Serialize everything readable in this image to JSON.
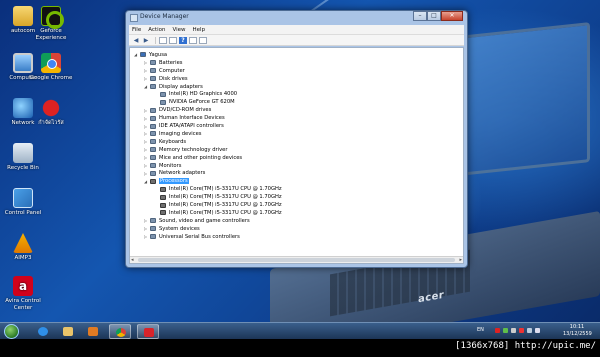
{
  "desktop": {
    "icons": [
      {
        "label": "autocom",
        "icon": "folder-icon"
      },
      {
        "label": "Geforce Experience",
        "icon": "geforce-icon"
      },
      {
        "label": "Computer",
        "icon": "computer-icon"
      },
      {
        "label": "Google Chrome",
        "icon": "chrome-icon"
      },
      {
        "label": "Network",
        "icon": "network-icon"
      },
      {
        "label": "กำจัดไวรัส",
        "icon": "bug-icon"
      },
      {
        "label": "Recycle Bin",
        "icon": "recycle-bin-icon"
      },
      {
        "label": "Control Panel",
        "icon": "control-panel-icon"
      },
      {
        "label": "AIMP3",
        "icon": "aimp-icon"
      },
      {
        "label": "Avira Control Center",
        "icon": "avira-icon"
      }
    ],
    "wallpaper_logo": "acer"
  },
  "window": {
    "title": "Device Manager",
    "controls": {
      "minimize": "–",
      "maximize": "□",
      "close": "✕"
    },
    "menu": [
      "File",
      "Action",
      "View",
      "Help"
    ],
    "tree": [
      {
        "label": "Yagusa",
        "level": 0,
        "expander": "◢",
        "icon": "computer-icon"
      },
      {
        "label": "Batteries",
        "level": 1,
        "expander": "▷",
        "icon": "battery-icon"
      },
      {
        "label": "Computer",
        "level": 1,
        "expander": "▷",
        "icon": "computer-icon"
      },
      {
        "label": "Disk drives",
        "level": 1,
        "expander": "▷",
        "icon": "disk-icon"
      },
      {
        "label": "Display adapters",
        "level": 1,
        "expander": "◢",
        "icon": "display-icon"
      },
      {
        "label": "Intel(R) HD Graphics 4000",
        "level": 2,
        "expander": "",
        "icon": "display-icon"
      },
      {
        "label": "NVIDIA GeForce GT 620M",
        "level": 2,
        "expander": "",
        "icon": "display-icon"
      },
      {
        "label": "DVD/CD-ROM drives",
        "level": 1,
        "expander": "▷",
        "icon": "dvd-icon"
      },
      {
        "label": "Human Interface Devices",
        "level": 1,
        "expander": "▷",
        "icon": "hid-icon"
      },
      {
        "label": "IDE ATA/ATAPI controllers",
        "level": 1,
        "expander": "▷",
        "icon": "ide-icon"
      },
      {
        "label": "Imaging devices",
        "level": 1,
        "expander": "▷",
        "icon": "camera-icon"
      },
      {
        "label": "Keyboards",
        "level": 1,
        "expander": "▷",
        "icon": "keyboard-icon"
      },
      {
        "label": "Memory technology driver",
        "level": 1,
        "expander": "▷",
        "icon": "memory-icon"
      },
      {
        "label": "Mice and other pointing devices",
        "level": 1,
        "expander": "▷",
        "icon": "mouse-icon"
      },
      {
        "label": "Monitors",
        "level": 1,
        "expander": "▷",
        "icon": "monitor-icon"
      },
      {
        "label": "Network adapters",
        "level": 1,
        "expander": "▷",
        "icon": "network-icon"
      },
      {
        "label": "Processors",
        "level": 1,
        "expander": "◢",
        "icon": "cpu-icon",
        "selected": true
      },
      {
        "label": "Intel(R) Core(TM) i5-3317U CPU @ 1.70GHz",
        "level": 2,
        "expander": "",
        "icon": "cpu-icon"
      },
      {
        "label": "Intel(R) Core(TM) i5-3317U CPU @ 1.70GHz",
        "level": 2,
        "expander": "",
        "icon": "cpu-icon"
      },
      {
        "label": "Intel(R) Core(TM) i5-3317U CPU @ 1.70GHz",
        "level": 2,
        "expander": "",
        "icon": "cpu-icon"
      },
      {
        "label": "Intel(R) Core(TM) i5-3317U CPU @ 1.70GHz",
        "level": 2,
        "expander": "",
        "icon": "cpu-icon"
      },
      {
        "label": "Sound, video and game controllers",
        "level": 1,
        "expander": "▷",
        "icon": "sound-icon"
      },
      {
        "label": "System devices",
        "level": 1,
        "expander": "▷",
        "icon": "system-icon"
      },
      {
        "label": "Universal Serial Bus controllers",
        "level": 1,
        "expander": "▷",
        "icon": "usb-icon"
      }
    ]
  },
  "taskbar": {
    "pinned": [
      "start-orb",
      "internet-explorer-icon",
      "windows-explorer-icon",
      "media-player-icon",
      "chrome-icon",
      "active-app-icon"
    ],
    "language": "EN",
    "time": "10:11",
    "date": "13/12/2559"
  },
  "caption": "[1366x768] http://upic.me/",
  "colors": {
    "selection": "#3399ff",
    "window_frame": "#aac4e6",
    "taskbar": "#1c3556"
  }
}
